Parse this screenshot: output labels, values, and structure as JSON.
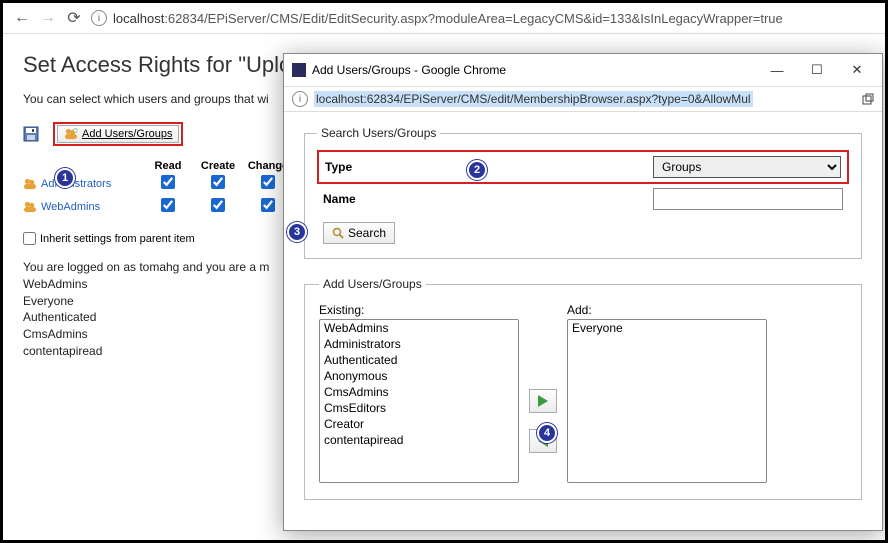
{
  "browser": {
    "url_host": "localhost",
    "url_rest": ":62834/EPiServer/CMS/Edit/EditSecurity.aspx?moduleArea=LegacyCMS&id=133&IsInLegacyWrapper=true"
  },
  "page": {
    "title": "Set Access Rights for \"Uplo",
    "description": "You can select which users and groups that wi"
  },
  "toolbar": {
    "add_users_groups_label": "Add Users/Groups"
  },
  "perm": {
    "headers": {
      "read": "Read",
      "create": "Create",
      "change": "Change"
    },
    "rows": [
      {
        "name": "Administrators",
        "read": true,
        "create": true,
        "change": true
      },
      {
        "name": "WebAdmins",
        "read": true,
        "create": true,
        "change": true
      }
    ]
  },
  "inherit_label": "Inherit settings from parent item",
  "logged": {
    "line1": "You are logged on as tomahg and you are a m",
    "groups": [
      "WebAdmins",
      "Everyone",
      "Authenticated",
      "CmsAdmins",
      "contentapiread"
    ]
  },
  "popup": {
    "title": "Add Users/Groups - Google Chrome",
    "url_host": "localhost",
    "url_rest": ":62834/EPiServer/CMS/edit/MembershipBrowser.aspx?type=0&AllowMul",
    "search_legend": "Search Users/Groups",
    "type_label": "Type",
    "type_value": "Groups",
    "name_label": "Name",
    "name_value": "",
    "search_btn": "Search",
    "add_legend": "Add Users/Groups",
    "existing_label": "Existing:",
    "add_label": "Add:",
    "existing_items": [
      "WebAdmins",
      "Administrators",
      "Authenticated",
      "Anonymous",
      "CmsAdmins",
      "CmsEditors",
      "Creator",
      "contentapiread"
    ],
    "add_items": [
      "Everyone"
    ]
  },
  "annotations": {
    "a1": "1",
    "a2": "2",
    "a3": "3",
    "a4": "4"
  }
}
